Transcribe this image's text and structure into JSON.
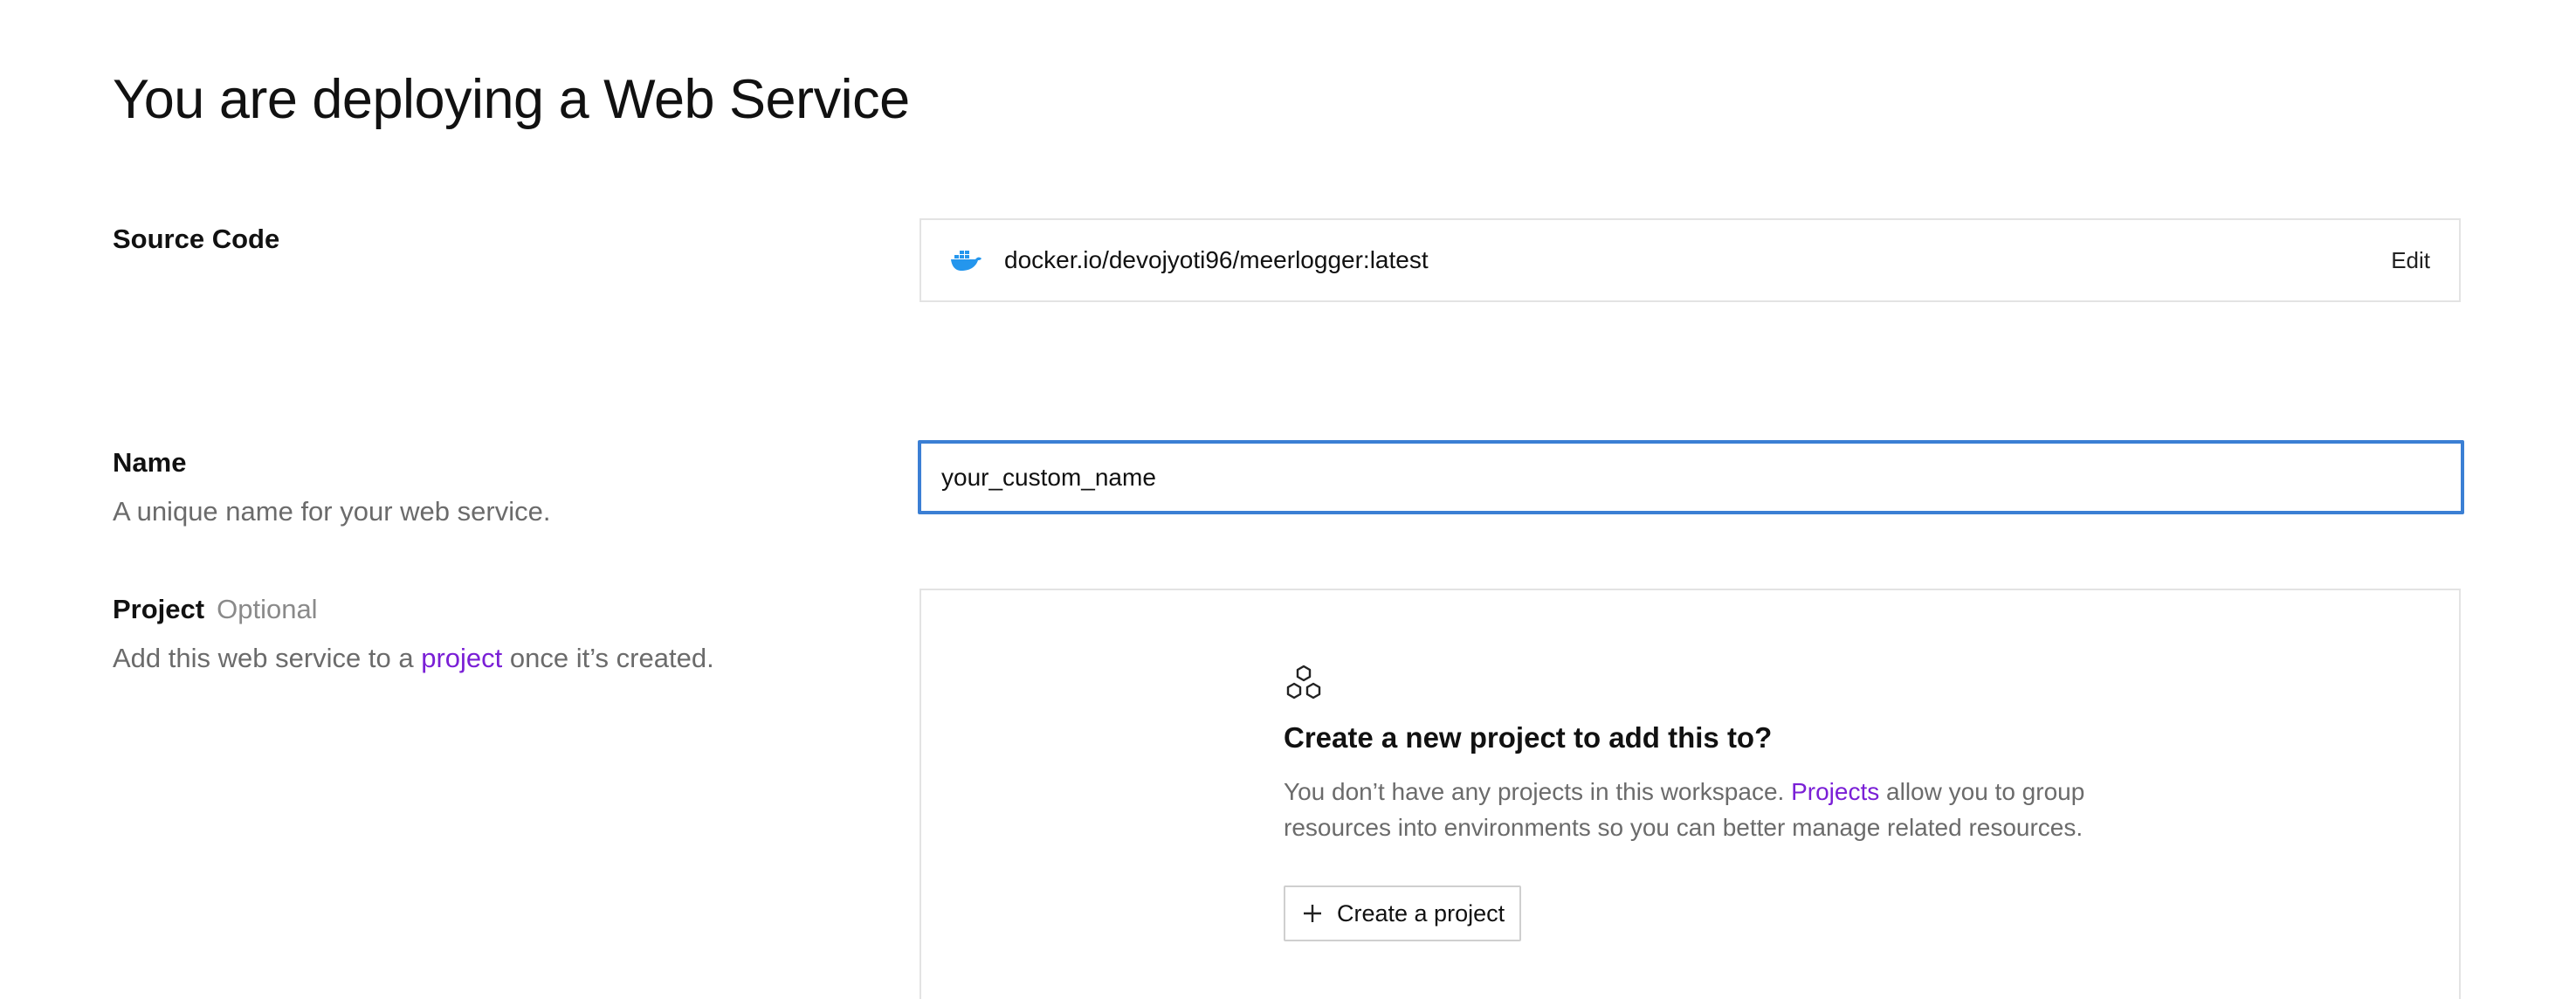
{
  "page": {
    "title": "You are deploying a Web Service"
  },
  "source_code": {
    "label": "Source Code",
    "icon": "docker-icon",
    "value": "docker.io/devojyoti96/meerlogger:latest",
    "edit_label": "Edit"
  },
  "name": {
    "label": "Name",
    "description": "A unique name for your web service.",
    "value": "your_custom_name"
  },
  "project": {
    "label": "Project",
    "optional": "Optional",
    "description_before": "Add this web service to a ",
    "description_link": "project",
    "description_after": " once it’s created.",
    "panel": {
      "icon": "hexagons-icon",
      "title": "Create a new project to add this to?",
      "text_before": "You don’t have any projects in this workspace. ",
      "text_link": "Projects",
      "text_after": " allow you to group resources into environments so you can better manage related resources.",
      "button_label": "Create a project"
    }
  },
  "colors": {
    "accent_link": "#7a1fd6",
    "focus_border": "#3b7fd4",
    "docker_blue": "#2496ed"
  }
}
